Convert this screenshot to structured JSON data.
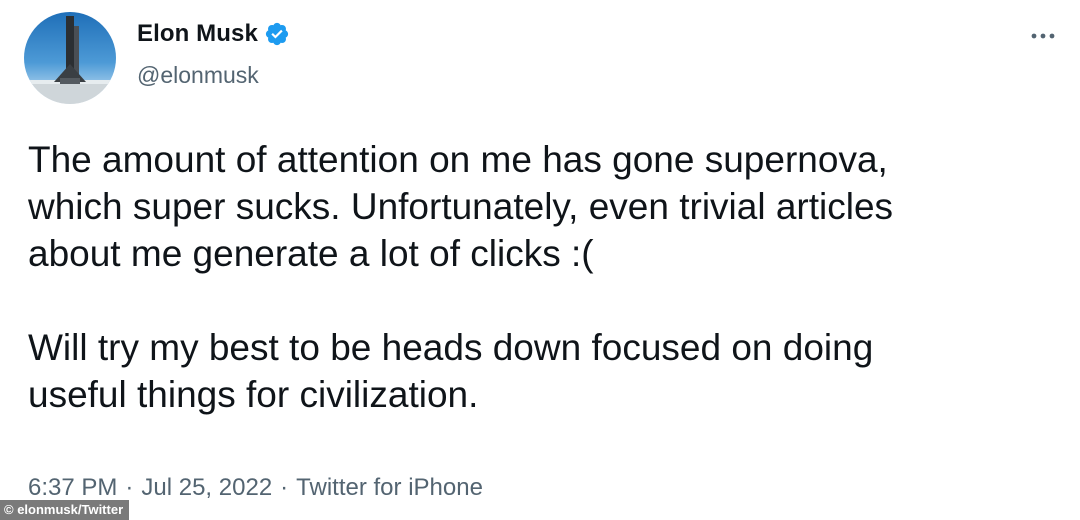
{
  "author": {
    "display_name": "Elon Musk",
    "handle": "@elonmusk",
    "verified": true,
    "avatar_icon": "rocket-launch-avatar"
  },
  "header": {
    "more_icon": "more-dots-icon"
  },
  "tweet": {
    "paragraphs": [
      "The amount of attention on me has gone supernova,\nwhich super sucks. Unfortunately, even trivial articles\nabout me generate a lot of clicks :(",
      "Will try my best to be heads down focused on doing\nuseful things for civilization."
    ]
  },
  "meta": {
    "time": "6:37 PM",
    "separator": "·",
    "date": "Jul 25, 2022",
    "source": "Twitter for iPhone"
  },
  "credit": "© elonmusk/Twitter",
  "colors": {
    "verified_blue": "#1d9bf0",
    "secondary_text": "#536471",
    "primary_text": "#0f1419"
  }
}
